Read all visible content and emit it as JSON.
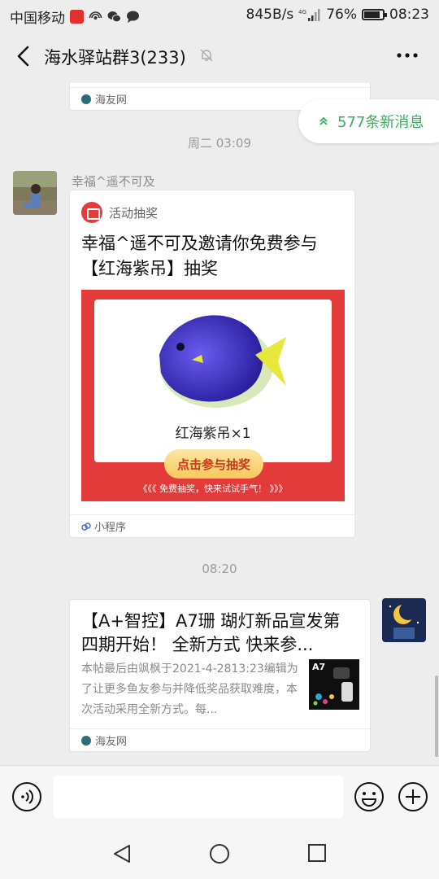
{
  "status_bar": {
    "carrier": "中国移动",
    "network_speed": "845B/s",
    "network_type": "4G",
    "battery": "76%",
    "time": "08:23"
  },
  "header": {
    "title": "海水驿站群3(233)"
  },
  "new_messages": {
    "label": "577条新消息"
  },
  "messages": [
    {
      "type": "link-card-partial",
      "source": "海友网"
    },
    {
      "type": "timestamp",
      "text": "周二 03:09"
    },
    {
      "type": "mini-program",
      "sender": "幸福^遥不可及",
      "app_label": "活动抽奖",
      "title": "幸福^遥不可及邀请你免费参与【红海紫吊】抽奖",
      "prize": "红海紫吊×1",
      "button": "点击参与抽奖",
      "tip": "免费抽奖，快来试试手气！",
      "tip_left": "《《《",
      "tip_right": "》》》",
      "footer": "小程序"
    },
    {
      "type": "timestamp",
      "text": "08:20"
    },
    {
      "type": "link-card",
      "title": "【A+智控】A7珊 瑚灯新品宣发第四期开始！ 全新方式  快来参...",
      "description": "本帖最后由飒枫于2021-4-2813:23编辑为了让更多鱼友参与并降低奖品获取难度，本次活动采用全新方式。每...",
      "thumb_label": "A7",
      "source": "海友网"
    }
  ],
  "colors": {
    "accent_green": "#3bac5d",
    "lottery_red": "#e33b39",
    "background": "#ededed"
  }
}
